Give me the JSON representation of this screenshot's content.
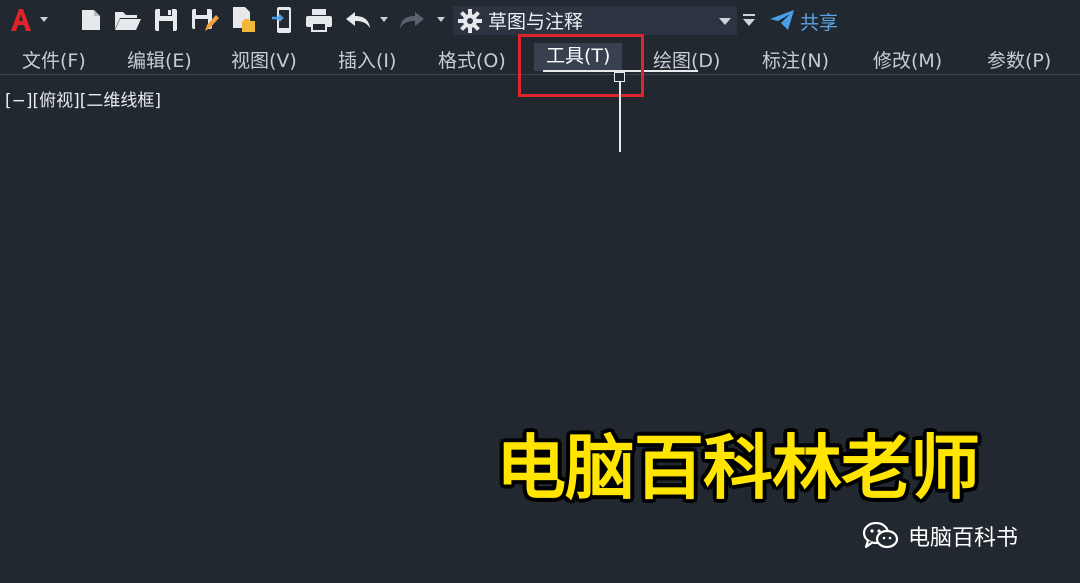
{
  "toolbar": {
    "app_icon": "autocad-a-icon",
    "workspace": {
      "value": "草图与注释",
      "icon": "gear-icon"
    },
    "share_label": "共享",
    "icons": [
      "new-file-icon",
      "open-folder-icon",
      "save-icon",
      "save-as-icon",
      "publish-icon",
      "mobile-share-icon",
      "print-icon",
      "undo-icon",
      "redo-icon",
      "customize-dropdown-icon",
      "paper-plane-icon"
    ]
  },
  "menubar": {
    "items": [
      {
        "label": "文件(F)"
      },
      {
        "label": "编辑(E)"
      },
      {
        "label": "视图(V)"
      },
      {
        "label": "插入(I)"
      },
      {
        "label": "格式(O)"
      },
      {
        "label": "工具(T)",
        "active": true
      },
      {
        "label": "绘图(D)"
      },
      {
        "label": "标注(N)"
      },
      {
        "label": "修改(M)"
      },
      {
        "label": "参数(P)"
      }
    ]
  },
  "viewport": {
    "label": "[−][俯视][二维线框]"
  },
  "overlay": {
    "watermark": "电脑百科林老师",
    "brand": "电脑百科书",
    "highlight_color": "#e0242b",
    "watermark_color": "#ffe500"
  },
  "colors": {
    "background": "#212830",
    "accent": "#5aa3e6",
    "app_red": "#e0242b"
  }
}
